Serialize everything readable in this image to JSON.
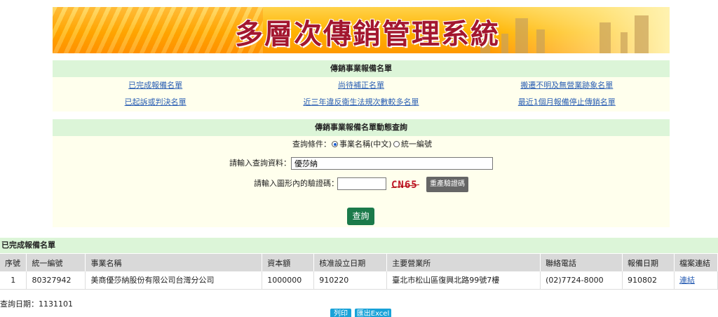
{
  "banner": {
    "title": "多層次傳銷管理系統"
  },
  "registry_panel": {
    "heading": "傳銷事業報備名單",
    "links_row1": [
      "已完成報備名單",
      "尚待補正名單",
      "搬遷不明及無營業跡象名單"
    ],
    "links_row2": [
      "已起訴或判決名單",
      "近三年違反衛生法規次數較多名單",
      "最近1個月報備停止傳銷名單"
    ]
  },
  "query_panel": {
    "heading": "傳銷事業報備名單動態查詢",
    "condition_label": "查詢條件：",
    "option_name": "事業名稱(中文)",
    "option_id": "統一編號",
    "input_label": "請輸入查詢資料：",
    "input_value": "優莎納",
    "captcha_label": "請輸入圖形內的驗證碼：",
    "captcha_text": "CN65",
    "regen_button": "重產驗證碼",
    "submit_button": "查詢"
  },
  "results": {
    "heading": "已完成報備名單",
    "columns": [
      "序號",
      "統一編號",
      "事業名稱",
      "資本額",
      "核准設立日期",
      "主要營業所",
      "聯絡電話",
      "報備日期",
      "檔案連結"
    ],
    "rows": [
      [
        "1",
        "80327942",
        "美商優莎納股份有限公司台灣分公司",
        "1000000",
        "910220",
        "臺北市松山區復興北路99號7樓",
        "(02)7724-8000",
        "910802",
        "連結"
      ]
    ]
  },
  "footer": {
    "query_date": "查詢日期：1131101",
    "print_button": "列印",
    "export_button": "匯出Excel"
  }
}
